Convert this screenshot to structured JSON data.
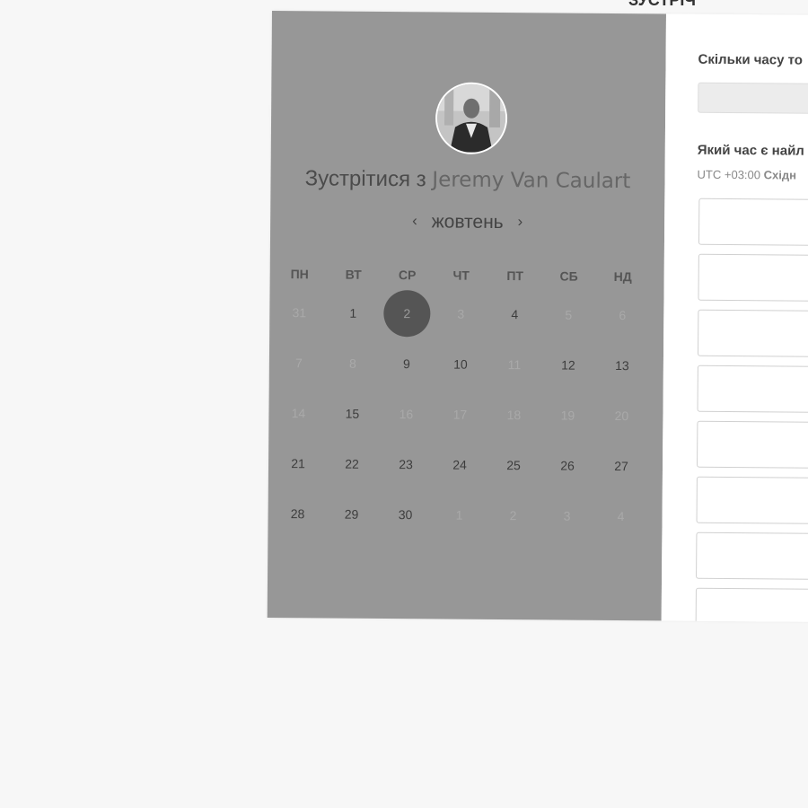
{
  "page_header": "ЗУСТРІЧ",
  "booking": {
    "title_prefix": "Зустрітися з",
    "host_name": "Jeremy Van Caulart",
    "month": "жовтень",
    "prev_arrow": "‹",
    "next_arrow": "›",
    "weekdays": [
      "ПН",
      "ВТ",
      "СР",
      "ЧТ",
      "ПТ",
      "СБ",
      "НД"
    ],
    "days": [
      {
        "label": "31",
        "muted": true
      },
      {
        "label": "1",
        "muted": false
      },
      {
        "label": "2",
        "muted": false,
        "selected": true
      },
      {
        "label": "3",
        "muted": true
      },
      {
        "label": "4",
        "muted": false
      },
      {
        "label": "5",
        "muted": true
      },
      {
        "label": "6",
        "muted": true
      },
      {
        "label": "7",
        "muted": true
      },
      {
        "label": "8",
        "muted": true
      },
      {
        "label": "9",
        "muted": false
      },
      {
        "label": "10",
        "muted": false
      },
      {
        "label": "11",
        "muted": true
      },
      {
        "label": "12",
        "muted": false
      },
      {
        "label": "13",
        "muted": false
      },
      {
        "label": "14",
        "muted": true
      },
      {
        "label": "15",
        "muted": false
      },
      {
        "label": "16",
        "muted": true
      },
      {
        "label": "17",
        "muted": true
      },
      {
        "label": "18",
        "muted": true
      },
      {
        "label": "19",
        "muted": true
      },
      {
        "label": "20",
        "muted": true
      },
      {
        "label": "21",
        "muted": false
      },
      {
        "label": "22",
        "muted": false
      },
      {
        "label": "23",
        "muted": false
      },
      {
        "label": "24",
        "muted": false
      },
      {
        "label": "25",
        "muted": false
      },
      {
        "label": "26",
        "muted": false
      },
      {
        "label": "27",
        "muted": false
      },
      {
        "label": "28",
        "muted": false
      },
      {
        "label": "29",
        "muted": false
      },
      {
        "label": "30",
        "muted": false
      },
      {
        "label": "1",
        "muted": true
      },
      {
        "label": "2",
        "muted": true
      },
      {
        "label": "3",
        "muted": true
      },
      {
        "label": "4",
        "muted": true
      }
    ]
  },
  "form": {
    "duration_question": "Скільки часу то",
    "time_question": "Який час є найл",
    "timezone_offset": "UTC +03:00",
    "timezone_name": "Східн",
    "time_slot_count": 8
  },
  "colors": {
    "left_panel": "#979797",
    "selected_day": "#555555",
    "page_background": "#f7f7f7"
  }
}
